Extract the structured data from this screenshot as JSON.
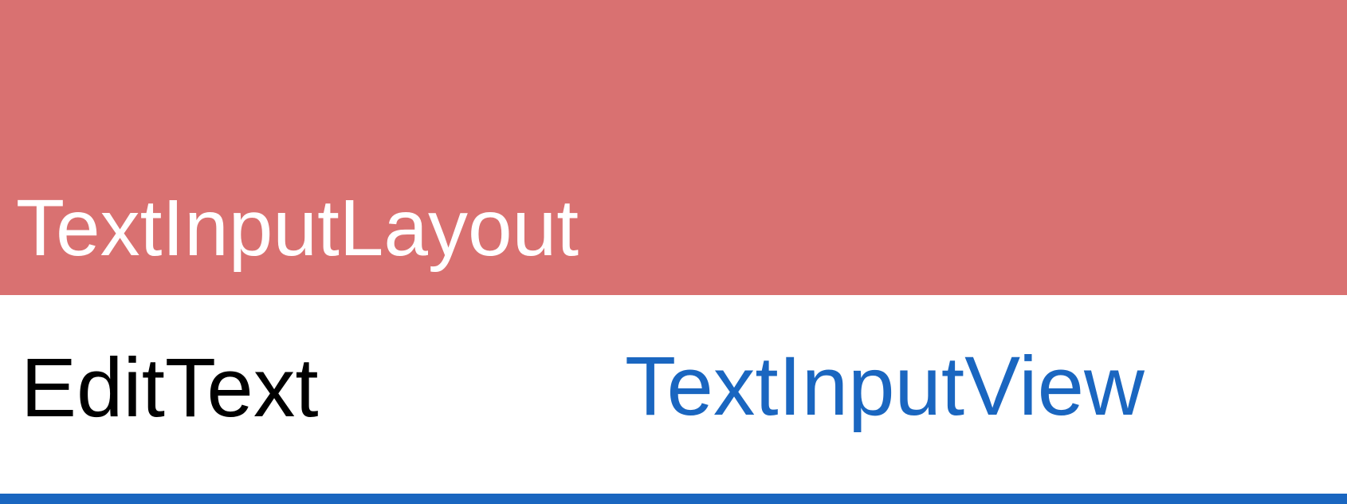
{
  "labels": {
    "layout": "TextInputLayout",
    "edit_text": "EditText",
    "input_view": "TextInputView"
  },
  "colors": {
    "layout_fill": "#d97171",
    "layout_text": "#ffffff",
    "edit_text": "#000000",
    "input_view_text": "#1a66c0",
    "underline": "#1a66c0",
    "background": "#ffffff"
  }
}
